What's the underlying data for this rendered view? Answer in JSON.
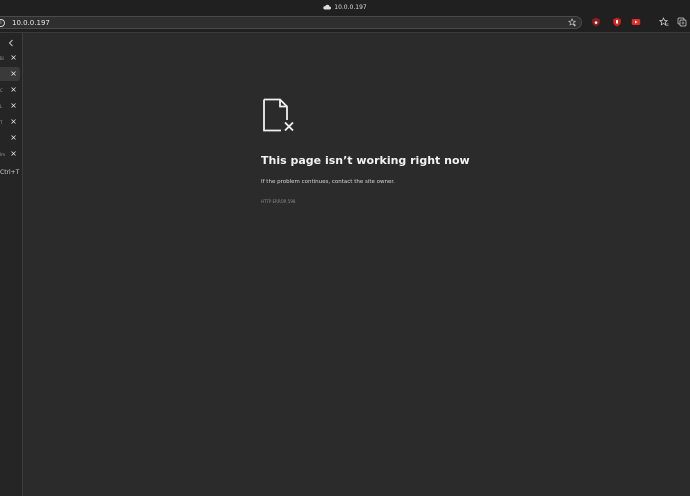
{
  "window": {
    "title": "10.0.0.197"
  },
  "address_bar": {
    "url": "10.0.0.197"
  },
  "toolbar": {
    "extensions": [
      {
        "name": "ublock-icon",
        "color": "#c92c2c"
      },
      {
        "name": "lastpass-icon",
        "color": "#d32020"
      },
      {
        "name": "youtube-icon",
        "color": "#e52d27"
      }
    ],
    "accent": "#e52d27"
  },
  "sidebar": {
    "tabs": [
      {
        "fragment": "Bi"
      },
      {
        "fragment": ""
      },
      {
        "fragment": "C"
      },
      {
        "fragment": "L"
      },
      {
        "fragment": "T"
      },
      {
        "fragment": ""
      },
      {
        "fragment": "Im"
      }
    ],
    "new_tab_shortcut": "Ctrl+T"
  },
  "error_page": {
    "title": "This page isn’t working right now",
    "message": "If the problem continues, contact the site owner.",
    "code": "HTTP ERROR 598"
  }
}
